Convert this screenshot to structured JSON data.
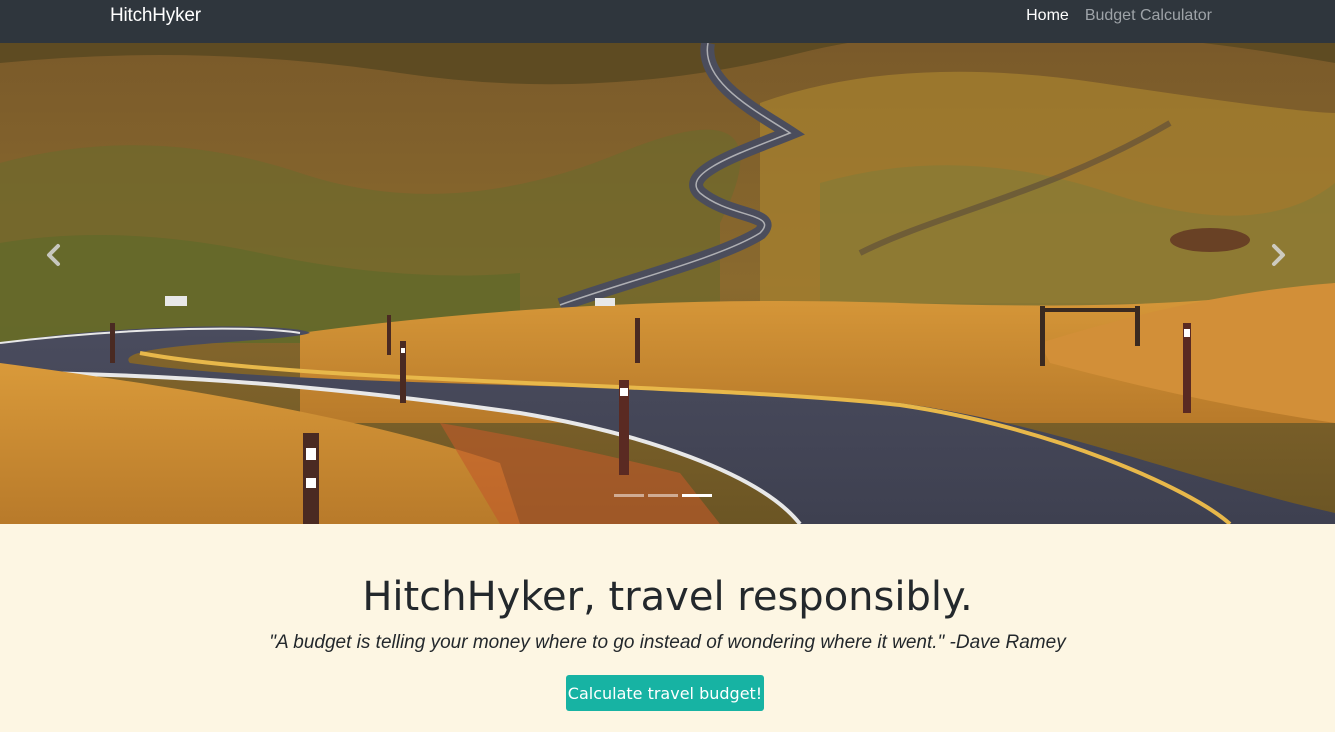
{
  "navbar": {
    "brand": "HitchHyker",
    "links": [
      {
        "label": "Home",
        "active": true
      },
      {
        "label": "Budget Calculator",
        "active": false
      }
    ]
  },
  "carousel": {
    "image_description_icon": "landscape-road-photo",
    "prev_icon": "chevron-left-icon",
    "next_icon": "chevron-right-icon",
    "slide_count": 3,
    "active_slide": 3
  },
  "hero": {
    "headline": "HitchHyker, travel responsibly.",
    "quote": "\"A budget is telling your money where to go instead of wondering where it went.\" -Dave Ramey",
    "cta_label": "Calculate travel budget!"
  },
  "colors": {
    "navbar_bg": "#2f363d",
    "page_bg": "#fdf6e3",
    "cta_bg": "#17b3a3"
  }
}
